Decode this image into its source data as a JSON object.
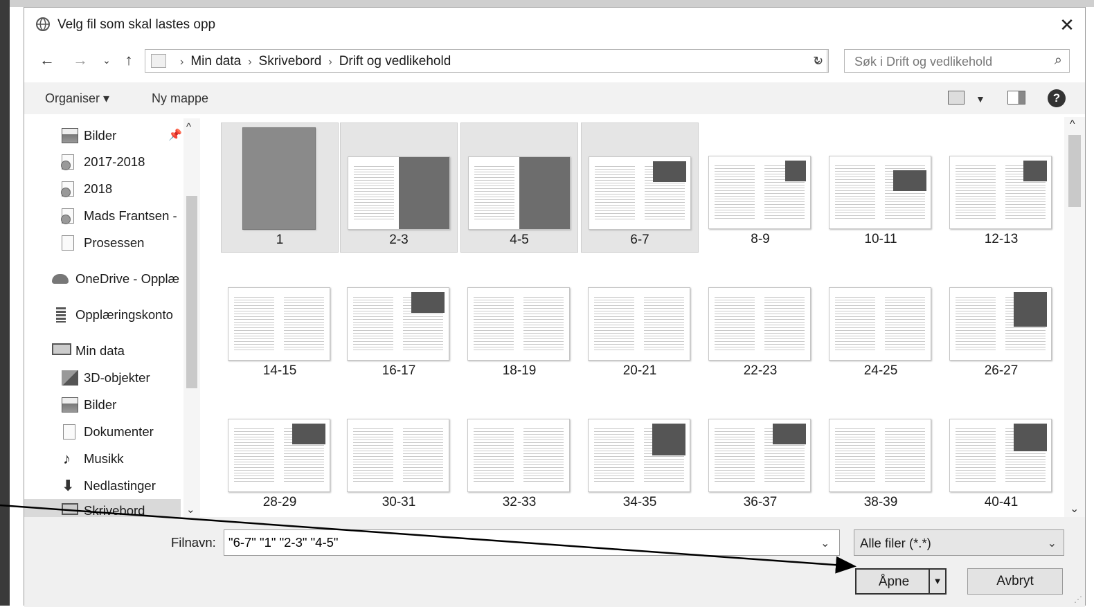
{
  "window": {
    "title": "Velg fil som skal lastes opp",
    "close_label": "✕"
  },
  "address": {
    "breadcrumbs": [
      "Min data",
      "Skrivebord",
      "Drift og vedlikehold"
    ],
    "search_placeholder": "Søk i Drift og vedlikehold"
  },
  "toolbar": {
    "organize_label": "Organiser ▾",
    "new_folder_label": "Ny mappe",
    "help_label": "?"
  },
  "nav": {
    "items": [
      {
        "label": "Bilder",
        "icon": "pictures-icon"
      },
      {
        "label": "2017-2018",
        "icon": "document-sync-icon"
      },
      {
        "label": "2018",
        "icon": "document-sync-icon"
      },
      {
        "label": "Mads Frantsen -",
        "icon": "document-sync-icon"
      },
      {
        "label": "Prosessen",
        "icon": "document-icon"
      },
      {
        "label": "OneDrive - Opplæ",
        "icon": "onedrive-cloud-icon"
      },
      {
        "label": "Opplæringskonto",
        "icon": "building-icon"
      },
      {
        "label": "Min data",
        "icon": "computer-icon"
      },
      {
        "label": "3D-objekter",
        "icon": "3d-objects-icon"
      },
      {
        "label": "Bilder",
        "icon": "pictures-icon"
      },
      {
        "label": "Dokumenter",
        "icon": "documents-icon"
      },
      {
        "label": "Musikk",
        "icon": "music-icon"
      },
      {
        "label": "Nedlastinger",
        "icon": "downloads-icon"
      },
      {
        "label": "Skrivebord",
        "icon": "desktop-icon"
      }
    ]
  },
  "files": [
    {
      "label": "1",
      "selected": true
    },
    {
      "label": "2-3",
      "selected": true
    },
    {
      "label": "4-5",
      "selected": true
    },
    {
      "label": "6-7",
      "selected": true
    },
    {
      "label": "8-9",
      "selected": false
    },
    {
      "label": "10-11",
      "selected": false
    },
    {
      "label": "12-13",
      "selected": false
    },
    {
      "label": "14-15",
      "selected": false
    },
    {
      "label": "16-17",
      "selected": false
    },
    {
      "label": "18-19",
      "selected": false
    },
    {
      "label": "20-21",
      "selected": false
    },
    {
      "label": "22-23",
      "selected": false
    },
    {
      "label": "24-25",
      "selected": false
    },
    {
      "label": "26-27",
      "selected": false
    },
    {
      "label": "28-29",
      "selected": false
    },
    {
      "label": "30-31",
      "selected": false
    },
    {
      "label": "32-33",
      "selected": false
    },
    {
      "label": "34-35",
      "selected": false
    },
    {
      "label": "36-37",
      "selected": false
    },
    {
      "label": "38-39",
      "selected": false
    },
    {
      "label": "40-41",
      "selected": false
    }
  ],
  "footer": {
    "filename_label": "Filnavn:",
    "filename_value": "\"6-7\" \"1\" \"2-3\" \"4-5\"",
    "filetype_value": "Alle filer (*.*)",
    "open_label": "Åpne",
    "cancel_label": "Avbryt"
  }
}
